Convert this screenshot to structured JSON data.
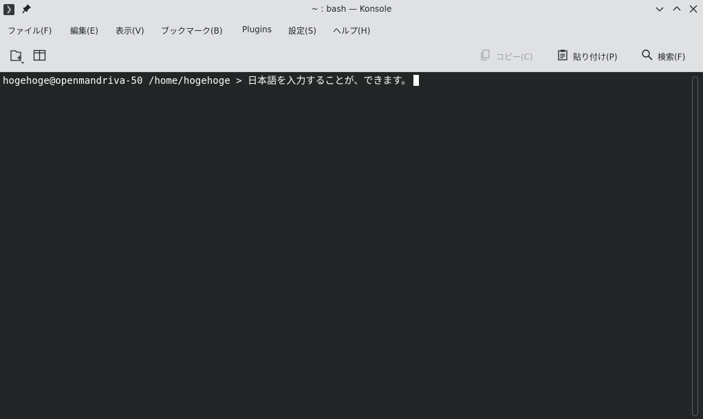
{
  "window": {
    "title": "~ : bash — Konsole",
    "app_icon": "terminal-icon",
    "pin_icon": "pin-icon",
    "controls": [
      "minimize-icon",
      "maximize-icon",
      "close-icon"
    ]
  },
  "menu": {
    "items": [
      {
        "label": "ファイル(F)"
      },
      {
        "label": "編集(E)"
      },
      {
        "label": "表示(V)"
      },
      {
        "label": "ブックマーク(B)"
      },
      {
        "label": "Plugins"
      },
      {
        "label": "設定(S)"
      },
      {
        "label": "ヘルプ(H)"
      }
    ]
  },
  "toolbar": {
    "new_tab_icon": "new-tab-icon",
    "split_view_icon": "split-view-icon",
    "copy_label": "コピー(C)",
    "paste_label": "貼り付け(P)",
    "find_label": "検索(F)"
  },
  "terminal": {
    "prompt": "hogehoge@openmandriva-50 /home/hogehoge > ",
    "input": "日本語を入力することが、できます。"
  },
  "colors": {
    "chrome_bg": "#e0e1e3",
    "terminal_bg": "#232627",
    "terminal_fg": "#fcfcfc"
  }
}
